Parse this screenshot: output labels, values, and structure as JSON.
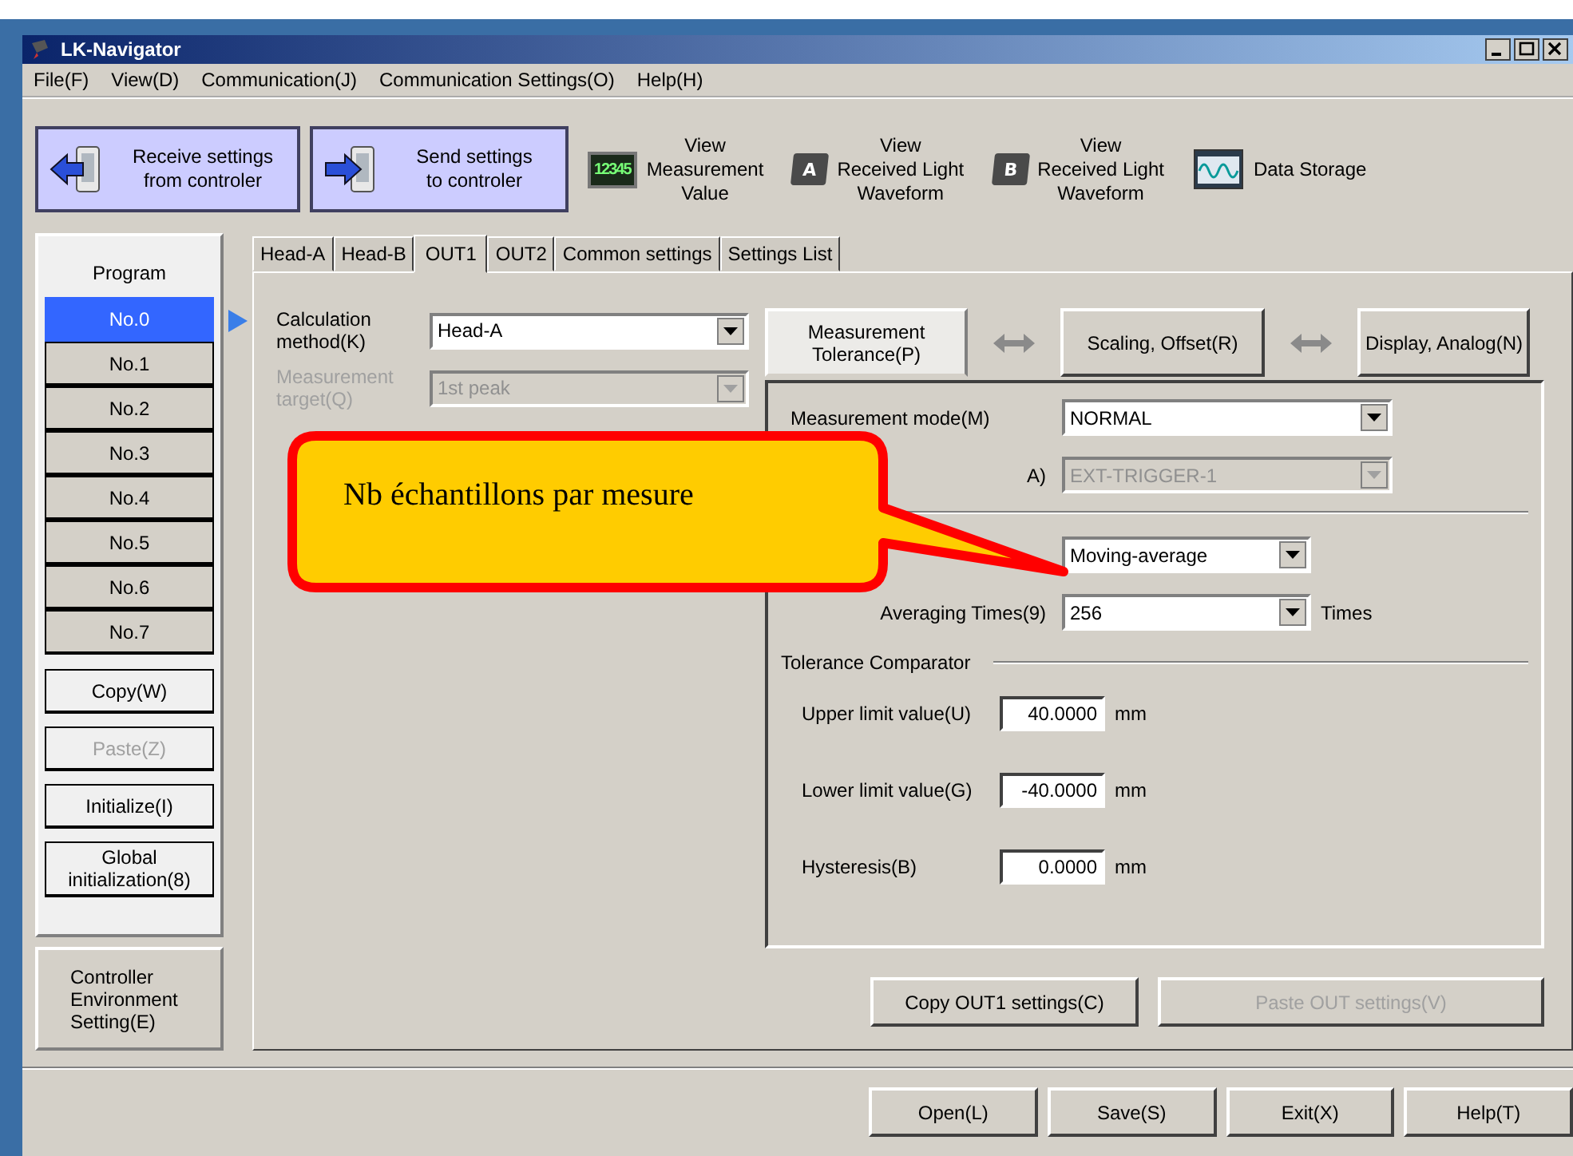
{
  "window": {
    "title": "LK-Navigator"
  },
  "menu": [
    "File(F)",
    "View(D)",
    "Communication(J)",
    "Communication Settings(O)",
    "Help(H)"
  ],
  "toolbar": [
    {
      "kind": "receive",
      "lines": [
        "Receive settings",
        "from controler"
      ]
    },
    {
      "kind": "send",
      "lines": [
        "Send settings",
        "to controler"
      ]
    },
    {
      "kind": "counter",
      "badge": "12345",
      "lines": [
        "View",
        "Measurement",
        "Value"
      ]
    },
    {
      "kind": "head",
      "badge": "A",
      "lines": [
        "View",
        "Received Light",
        "Waveform"
      ]
    },
    {
      "kind": "head",
      "badge": "B",
      "lines": [
        "View",
        "Received Light",
        "Waveform"
      ]
    },
    {
      "kind": "storage",
      "lines": [
        "Data Storage"
      ]
    }
  ],
  "program": {
    "title": "Program",
    "items": [
      {
        "label": "No.0",
        "selected": true
      },
      {
        "label": "No.1",
        "selected": false
      },
      {
        "label": "No.2",
        "selected": false
      },
      {
        "label": "No.3",
        "selected": false
      },
      {
        "label": "No.4",
        "selected": false
      },
      {
        "label": "No.5",
        "selected": false
      },
      {
        "label": "No.6",
        "selected": false
      },
      {
        "label": "No.7",
        "selected": false
      }
    ],
    "actions": [
      {
        "lines": [
          "Copy(W)"
        ],
        "disabled": false
      },
      {
        "lines": [
          "Paste(Z)"
        ],
        "disabled": true
      },
      {
        "lines": [
          "Initialize(I)"
        ],
        "disabled": false
      },
      {
        "lines": [
          "Global",
          "initialization(8)"
        ],
        "disabled": false
      }
    ]
  },
  "environment_button": {
    "lines": [
      "Controller",
      "Environment",
      "Setting(E)"
    ]
  },
  "tabs": [
    {
      "label": "Head-A",
      "selected": false
    },
    {
      "label": "Head-B",
      "selected": false
    },
    {
      "label": "OUT1",
      "selected": true
    },
    {
      "label": "OUT2",
      "selected": false
    },
    {
      "label": "Common settings",
      "selected": false
    },
    {
      "label": "Settings List",
      "selected": false
    }
  ],
  "calculation": [
    {
      "lines": [
        "Calculation",
        "method(K)"
      ],
      "value": "Head-A",
      "disabled": false
    },
    {
      "lines": [
        "Measurement",
        "target(Q)"
      ],
      "value": "1st peak",
      "disabled": true
    }
  ],
  "subtabs": [
    {
      "lines": [
        "Measurement",
        "Tolerance(P)"
      ],
      "selected": true
    },
    {
      "lines": [
        "Scaling, Offset(R)"
      ],
      "selected": false
    },
    {
      "lines": [
        "Display, Analog(N)"
      ],
      "selected": false
    }
  ],
  "mode_rows": [
    {
      "label": "Measurement mode(M)",
      "value": "NORMAL",
      "disabled": false
    },
    {
      "label": "A)",
      "value": "EXT-TRIGGER-1",
      "disabled": true
    }
  ],
  "averaging": {
    "mode": "Moving-average",
    "label": "Averaging Times(9)",
    "value": "256",
    "unit": "Times"
  },
  "tolerance": {
    "title": "Tolerance Comparator",
    "rows": [
      {
        "label": "Upper limit value(U)",
        "value": "40.0000",
        "unit": "mm"
      },
      {
        "label": "Lower limit value(G)",
        "value": "-40.0000",
        "unit": "mm"
      },
      {
        "label": "Hysteresis(B)",
        "value": "0.0000",
        "unit": "mm"
      }
    ]
  },
  "panel_buttons": [
    {
      "label": "Copy OUT1 settings(C)",
      "disabled": false
    },
    {
      "label": "Paste OUT settings(V)",
      "disabled": true
    }
  ],
  "footer_buttons": [
    "Open(L)",
    "Save(S)",
    "Exit(X)",
    "Help(T)"
  ],
  "callout": {
    "text": "Nb échantillons par mesure"
  }
}
